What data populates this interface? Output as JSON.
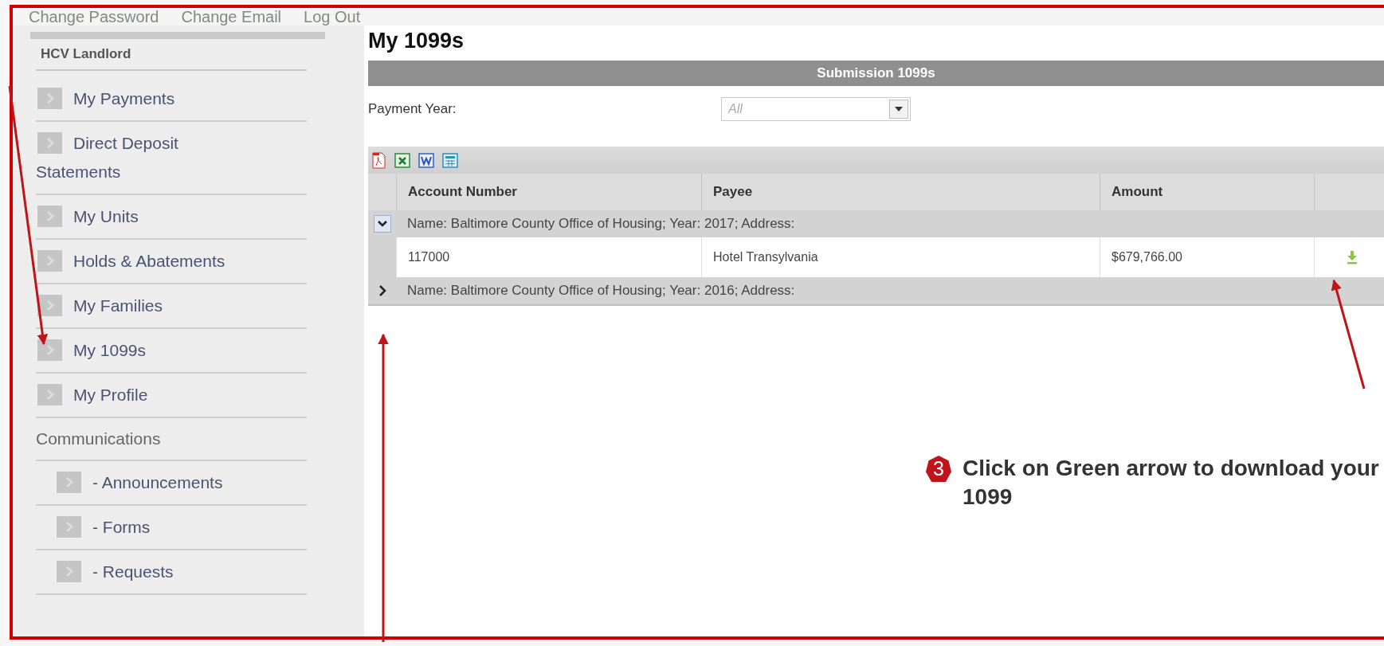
{
  "top_links": [
    {
      "label": "Change Password"
    },
    {
      "label": "Change Email"
    },
    {
      "label": "Log Out"
    }
  ],
  "sidebar": {
    "title": "HCV Landlord",
    "items": [
      {
        "kind": "item",
        "label": "My Payments"
      },
      {
        "kind": "item",
        "label": "Direct Deposit Statements"
      },
      {
        "kind": "item",
        "label": "My Units"
      },
      {
        "kind": "item",
        "label": "Holds & Abatements"
      },
      {
        "kind": "item",
        "label": "My Families"
      },
      {
        "kind": "item",
        "label": "My 1099s"
      },
      {
        "kind": "item",
        "label": "My Profile"
      },
      {
        "kind": "heading",
        "label": "Communications"
      },
      {
        "kind": "subitem",
        "label": "- Announcements"
      },
      {
        "kind": "subitem",
        "label": "- Forms"
      },
      {
        "kind": "subitem",
        "label": "- Requests"
      }
    ]
  },
  "page_title": "My 1099s",
  "panel": {
    "title": "Submission 1099s",
    "filter": {
      "label": "Payment Year:",
      "placeholder": "All"
    }
  },
  "table": {
    "columns": [
      "Account Number",
      "Payee",
      "Amount"
    ],
    "rows": [
      {
        "kind": "group",
        "expanded": true,
        "text": "Name: Baltimore County Office of Housing; Year: 2017; Address:"
      },
      {
        "kind": "record",
        "cells": [
          "117000",
          "Hotel Transylvania",
          "$679,766.00"
        ]
      },
      {
        "kind": "group",
        "expanded": false,
        "text": "Name: Baltimore County Office of Housing; Year: 2016; Address:"
      }
    ]
  },
  "annotation": {
    "badge": "3",
    "text": "Click on Green arrow to download your 1099"
  }
}
